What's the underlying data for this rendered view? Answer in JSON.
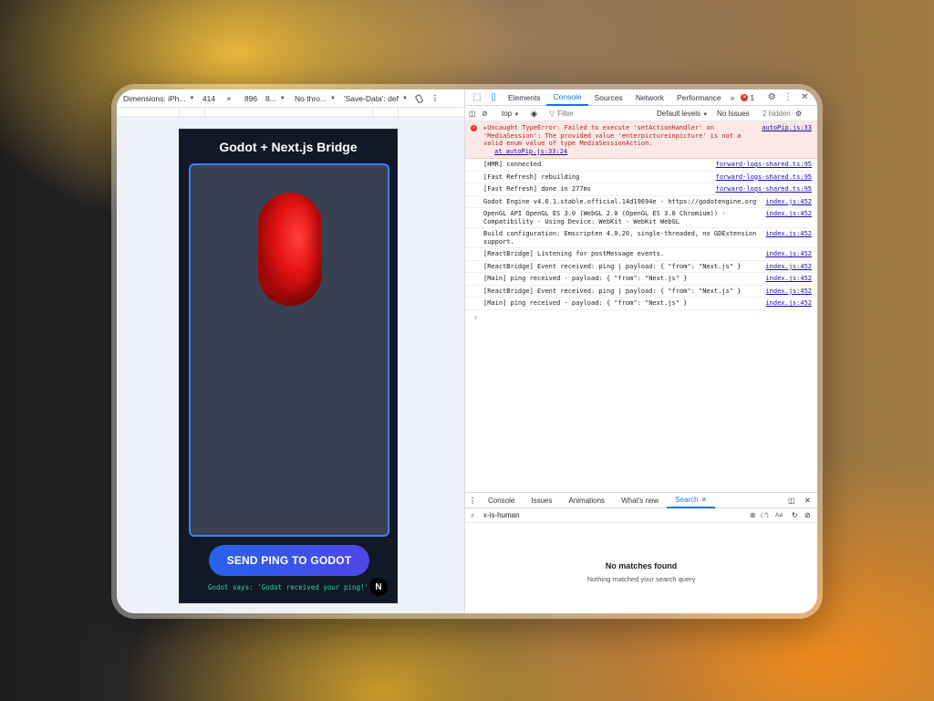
{
  "device_toolbar": {
    "dimensions_label": "Dimensions: iPh...",
    "width": "414",
    "times": "×",
    "height": "896",
    "zoom": "8...",
    "throttle": "No thro...",
    "save_data": "'Save-Data': def"
  },
  "app": {
    "title": "Godot + Next.js Bridge",
    "button_label": "SEND PING TO GODOT",
    "godot_says": "Godot says: 'Godot received your ping!'",
    "badge": "N"
  },
  "devtools": {
    "tabs": [
      "Elements",
      "Console",
      "Sources",
      "Network",
      "Performance"
    ],
    "active_tab": "Console",
    "more": "»",
    "error_count": "1",
    "console_bar": {
      "context": "top",
      "filter_placeholder": "Filter",
      "levels": "Default levels",
      "issues": "No Issues",
      "hidden": "2 hidden"
    },
    "logs": [
      {
        "type": "error",
        "msg": "▸Uncaught TypeError: Failed to execute 'setActionHandler' on 'MediaSession': The provided value 'enterpictureinpicture' is not a valid enum value of type MediaSessionAction.",
        "at": "at autoPip.js:33:24",
        "src": "autoPip.js:33"
      },
      {
        "type": "log",
        "msg": "[HMR] connected",
        "src": "forward-logs-shared.ts:95"
      },
      {
        "type": "log",
        "msg": "[Fast Refresh] rebuilding",
        "src": "forward-logs-shared.ts:95"
      },
      {
        "type": "log",
        "msg": "[Fast Refresh] done in 277ms",
        "src": "forward-logs-shared.ts:95"
      },
      {
        "type": "log",
        "msg": "Godot Engine v4.6.1.stable.official.14d19694e - https://godotengine.org",
        "src": "index.js:452"
      },
      {
        "type": "log",
        "msg": "OpenGL API OpenGL ES 3.0 (WebGL 2.0 (OpenGL ES 3.0 Chromium)) - Compatibility - Using Device: WebKit - WebKit WebGL",
        "src": "index.js:452"
      },
      {
        "type": "log",
        "msg": "Build configuration: Emscripten 4.0.20, single-threaded, no GDExtension support.",
        "src": "index.js:452"
      },
      {
        "type": "log",
        "msg": "[ReactBridge] Listening for postMessage events.",
        "src": "index.js:452"
      },
      {
        "type": "log",
        "msg": "[ReactBridge] Event received: ping | payload: { \"from\": \"Next.js\" }",
        "src": "index.js:452"
      },
      {
        "type": "log",
        "msg": "[Main] ping received - payload: { \"from\": \"Next.js\" }",
        "src": "index.js:452"
      },
      {
        "type": "log",
        "msg": "[ReactBridge] Event received: ping | payload: { \"from\": \"Next.js\" }",
        "src": "index.js:452"
      },
      {
        "type": "log",
        "msg": "[Main] ping received - payload: { \"from\": \"Next.js\" }",
        "src": "index.js:452"
      }
    ],
    "prompt": "›",
    "drawer_tabs": [
      "Console",
      "Issues",
      "Animations",
      "What's new",
      "Search"
    ],
    "active_drawer_tab": "Search",
    "search_query": "x-is-human",
    "search_regex": "(.*)",
    "search_case": "Aa",
    "no_matches_title": "No matches found",
    "no_matches_subtitle": "Nothing matched your search query"
  },
  "colors": {
    "accent": "#1a73e8",
    "error": "#d93025",
    "button_gradient_start": "#2563eb",
    "button_gradient_end": "#4f46e5",
    "godot_text": "#34d399",
    "capsule": "#e51313"
  },
  "icons": [
    "inspect-icon",
    "device-icon",
    "settings-gear-icon",
    "kebab-menu-icon",
    "sidebar-toggle-icon",
    "clear-console-icon",
    "eye-icon",
    "filter-icon",
    "search-icon",
    "refresh-icon",
    "close-icon",
    "rotate-icon"
  ]
}
